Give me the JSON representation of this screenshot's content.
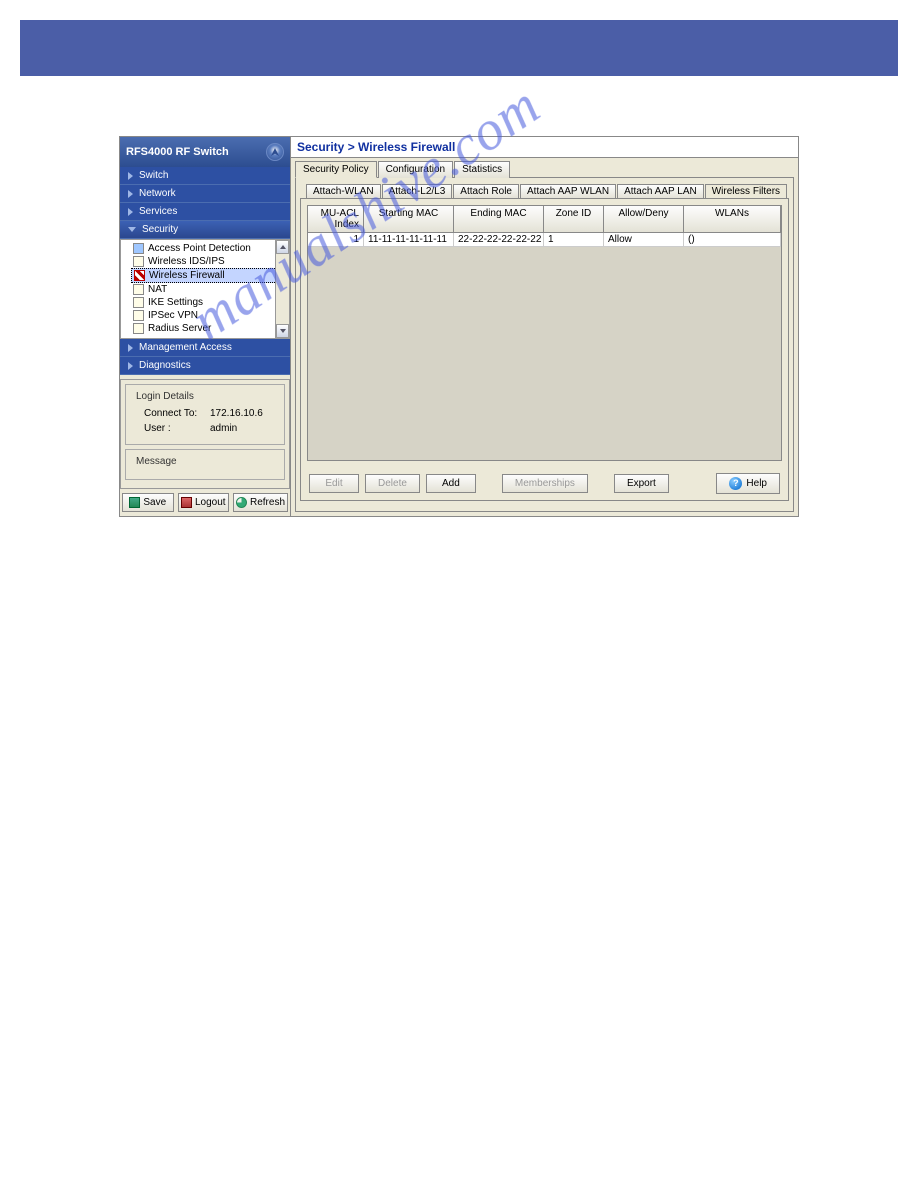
{
  "brand": {
    "title": "RFS4000 RF Switch"
  },
  "nav": {
    "switch": "Switch",
    "network": "Network",
    "services": "Services",
    "security": "Security",
    "management": "Management Access",
    "diagnostics": "Diagnostics"
  },
  "tree": {
    "items": [
      {
        "label": "Access Point Detection"
      },
      {
        "label": "Wireless IDS/IPS"
      },
      {
        "label": "Wireless Firewall"
      },
      {
        "label": "NAT"
      },
      {
        "label": "IKE Settings"
      },
      {
        "label": "IPSec VPN"
      },
      {
        "label": "Radius Server"
      }
    ]
  },
  "login": {
    "title": "Login Details",
    "connect_label": "Connect To:",
    "connect_value": "172.16.10.6",
    "user_label": "User :",
    "user_value": "admin"
  },
  "message": {
    "title": "Message"
  },
  "buttons": {
    "save": "Save",
    "logout": "Logout",
    "refresh": "Refresh"
  },
  "main": {
    "breadcrumb": "Security > Wireless Firewall",
    "top_tabs": [
      "Security Policy",
      "Configuration",
      "Statistics"
    ],
    "inner_tabs": [
      "Attach-WLAN",
      "Attach-L2/L3",
      "Attach Role",
      "Attach AAP WLAN",
      "Attach AAP LAN",
      "Wireless Filters"
    ],
    "columns": [
      "MU-ACL Index",
      "Starting MAC",
      "Ending MAC",
      "Zone ID",
      "Allow/Deny",
      "WLANs"
    ],
    "rows": [
      {
        "index": "1",
        "start": "11-11-11-11-11-11",
        "end": "22-22-22-22-22-22",
        "zone": "1",
        "allow": "Allow",
        "wlans": "()"
      }
    ],
    "actions": {
      "edit": "Edit",
      "delete": "Delete",
      "add": "Add",
      "memberships": "Memberships",
      "export": "Export",
      "help": "Help"
    }
  },
  "watermark": "manualshive.com"
}
